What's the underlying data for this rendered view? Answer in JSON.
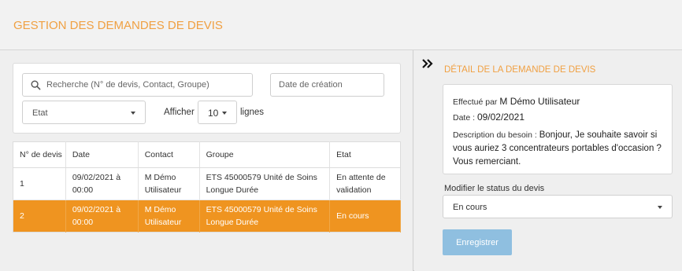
{
  "header": {
    "title": "GESTION DES DEMANDES DE DEVIS"
  },
  "filters": {
    "search_placeholder": "Recherche (N° de devis, Contact, Groupe)",
    "date_placeholder": "Date de création",
    "etat_value": "Etat",
    "afficher_label": "Afficher",
    "rows_value": "10",
    "lignes_label": "lignes"
  },
  "table": {
    "headers": [
      "N° de devis",
      "Date",
      "Contact",
      "Groupe",
      "Etat"
    ],
    "rows": [
      {
        "num": "1",
        "date_line1": "09/02/2021 à",
        "date_line2": "00:00",
        "contact_line1": "M Démo",
        "contact_line2": "Utilisateur",
        "groupe_line1": "ETS 45000579 Unité de Soins",
        "groupe_line2": "Longue Durée",
        "etat_line1": "En attente de",
        "etat_line2": "validation"
      },
      {
        "num": "2",
        "date_line1": "09/02/2021 à",
        "date_line2": "00:00",
        "contact_line1": "M Démo",
        "contact_line2": "Utilisateur",
        "groupe_line1": "ETS 45000579 Unité de Soins",
        "groupe_line2": "Longue Durée",
        "etat_line1": "En cours",
        "etat_line2": ""
      }
    ],
    "selected_row_color": "#ef9420"
  },
  "detail": {
    "title": "DÉTAIL DE LA DEMANDE DE DEVIS",
    "collapse_icon": "double-chevron-right-icon",
    "effectue_label": "Effectué par",
    "effectue_value": "M Démo Utilisateur",
    "date_label": "Date :",
    "date_value": "09/02/2021",
    "besoin_label": "Description du besoin :",
    "besoin_value": "Bonjour, Je souhaite savoir si vous auriez 3 concentrateurs portables d'occasion ? Vous remerciant.",
    "status_label": "Modifier le status du devis",
    "status_value": "En cours",
    "save_label": "Enregistrer"
  },
  "colors": {
    "accent": "#f0a042",
    "button": "#8fbfe0"
  }
}
